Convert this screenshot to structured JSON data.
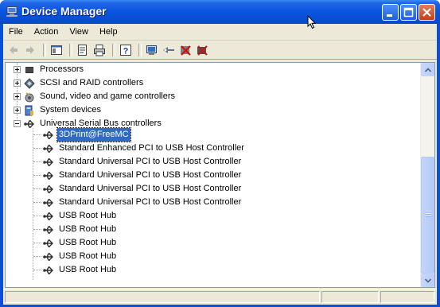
{
  "window": {
    "title": "Device Manager"
  },
  "title_buttons": [
    "minimize-icon",
    "maximize-icon",
    "close-icon"
  ],
  "menu": [
    "File",
    "Action",
    "View",
    "Help"
  ],
  "toolbar": {
    "icons": [
      "back-arrow-icon",
      "forward-arrow-icon",
      "show-hide-console-tree-icon",
      "properties-icon",
      "print-icon",
      "help-icon",
      "scan-hardware-icon",
      "update-driver-icon",
      "uninstall-icon",
      "disable-icon"
    ]
  },
  "tree": {
    "categories": [
      {
        "label": "Processors",
        "expanded": false,
        "icon": "processor-icon"
      },
      {
        "label": "SCSI and RAID controllers",
        "expanded": false,
        "icon": "scsi-icon"
      },
      {
        "label": "Sound, video and game controllers",
        "expanded": false,
        "icon": "sound-icon"
      },
      {
        "label": "System devices",
        "expanded": false,
        "icon": "system-devices-icon"
      },
      {
        "label": "Universal Serial Bus controllers",
        "expanded": true,
        "icon": "usb-icon"
      }
    ],
    "usb_children": [
      {
        "label": "3DPrint@FreeMC",
        "selected": true
      },
      {
        "label": "Standard Enhanced PCI to USB Host Controller"
      },
      {
        "label": "Standard Universal PCI to USB Host Controller"
      },
      {
        "label": "Standard Universal PCI to USB Host Controller"
      },
      {
        "label": "Standard Universal PCI to USB Host Controller"
      },
      {
        "label": "Standard Universal PCI to USB Host Controller"
      },
      {
        "label": "USB Root Hub"
      },
      {
        "label": "USB Root Hub"
      },
      {
        "label": "USB Root Hub"
      },
      {
        "label": "USB Root Hub"
      },
      {
        "label": "USB Root Hub"
      }
    ]
  },
  "colors": {
    "titlebar": "#0a55e0",
    "selection": "#316ac5",
    "frame": "#ece9d8"
  }
}
